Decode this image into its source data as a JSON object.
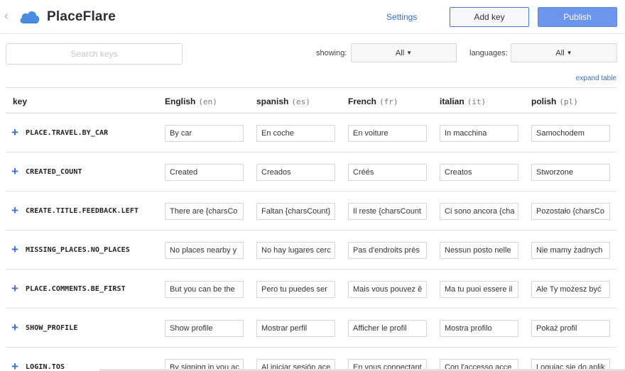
{
  "header": {
    "back_glyph": "‹",
    "app_title": "PlaceFlare",
    "settings_label": "Settings",
    "add_key_label": "Add key",
    "publish_label": "Publish",
    "logo_color": "#4a8de0"
  },
  "toolbar": {
    "search_placeholder": "Search keys",
    "showing_label": "showing:",
    "showing_value": "All",
    "languages_label": "languages:",
    "languages_value": "All",
    "expand_label": "expand table"
  },
  "table": {
    "key_header": "key",
    "languages": [
      {
        "name": "English",
        "code": "(en)"
      },
      {
        "name": "spanish",
        "code": "(es)"
      },
      {
        "name": "French",
        "code": "(fr)"
      },
      {
        "name": "italian",
        "code": "(it)"
      },
      {
        "name": "polish",
        "code": "(pl)"
      }
    ],
    "rows": [
      {
        "key": "PLACE.TRAVEL.BY_CAR",
        "values": [
          "By car",
          "En coche",
          "En voiture",
          "In macchina",
          "Samochodem"
        ]
      },
      {
        "key": "CREATED_COUNT",
        "values": [
          "Created",
          "Creados",
          "Créés",
          "Creatos",
          "Stworzone"
        ]
      },
      {
        "key": "CREATE.TITLE.FEEDBACK.LEFT",
        "values": [
          "There are {charsCo",
          "Faltan {charsCount}",
          "Il reste {charsCount",
          "Ci sono ancora {cha",
          "Pozostało {charsCo"
        ]
      },
      {
        "key": "MISSING_PLACES.NO_PLACES",
        "values": [
          "No places nearby y",
          "No hay lugares cerc",
          "Pas d'endroits près",
          "Nessun posto nelle",
          "Nie mamy żadnych"
        ]
      },
      {
        "key": "PLACE.COMMENTS.BE_FIRST",
        "values": [
          "But you can be the",
          "Pero tu puedes ser",
          "Mais vous pouvez ê",
          "Ma tu puoi essere il",
          "Ale Ty możesz być"
        ]
      },
      {
        "key": "SHOW_PROFILE",
        "values": [
          "Show profile",
          "Mostrar perfil",
          "Afficher le profil",
          "Mostra profilo",
          "Pokaż profil"
        ]
      },
      {
        "key": "LOGIN.TOS",
        "values": [
          "By signing in you ac",
          "Al iniciar sesión ace",
          "En vous connectant",
          "Con l'accesso acce",
          "Logujac się do aplik"
        ]
      }
    ]
  },
  "colors": {
    "accent": "#2f6fd6",
    "publish_bg": "#6d95ec",
    "plus_icon": "#3d6fcf"
  }
}
